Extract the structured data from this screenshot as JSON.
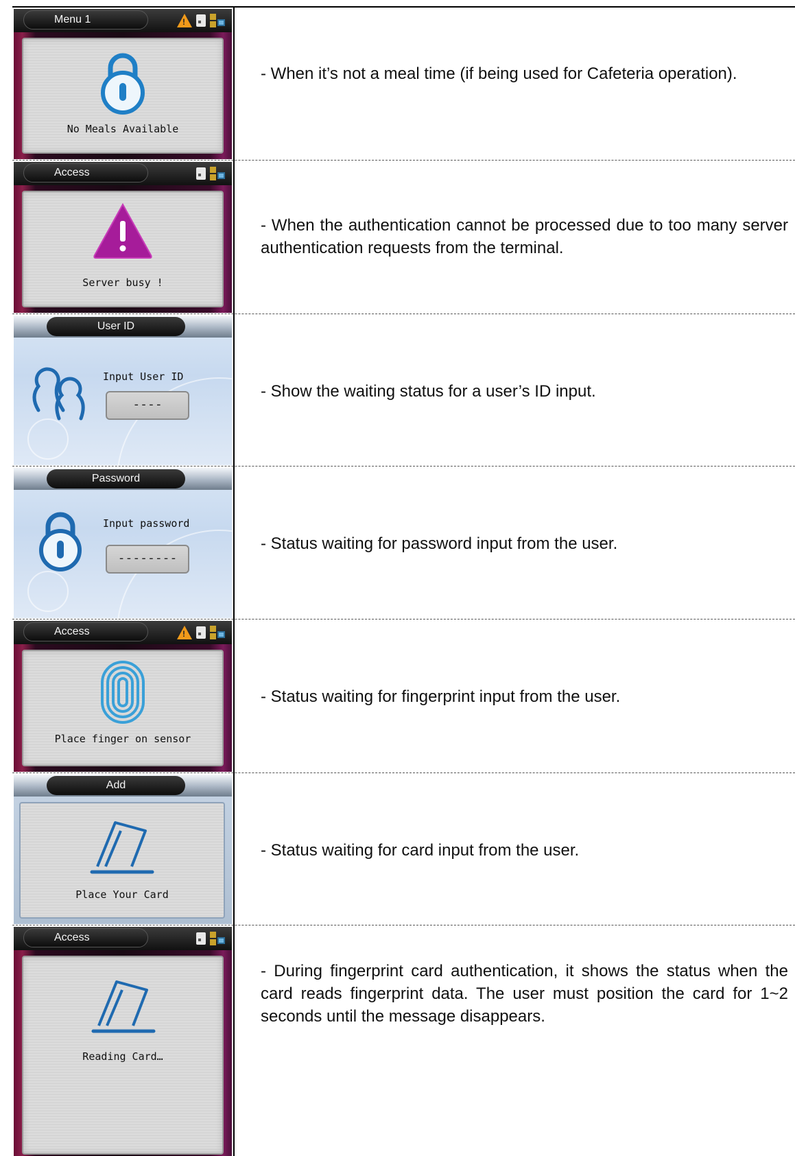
{
  "rows": [
    {
      "screen": {
        "title": "Menu 1",
        "label": "No Meals Available",
        "icon": "lock-icon",
        "theme": "dark",
        "status_icons": [
          "warning-icon",
          "sd-card-icon",
          "network-icon"
        ]
      },
      "description": "- When it’s not a meal time (if being used for Cafeteria operation)."
    },
    {
      "screen": {
        "title": "Access",
        "label": "Server busy !",
        "icon": "warning-triangle-icon",
        "theme": "dark",
        "status_icons": [
          "sd-card-icon",
          "network-icon"
        ]
      },
      "description": "- When the authentication cannot be processed due to too many server authentication requests from the terminal."
    },
    {
      "screen": {
        "title": "User ID",
        "label": "Input User ID",
        "input_value": "----",
        "icon": "users-icon",
        "theme": "light"
      },
      "description": "- Show the waiting status for a user’s ID input."
    },
    {
      "screen": {
        "title": "Password",
        "label": "Input password",
        "input_value": "--------",
        "icon": "lock-icon",
        "theme": "light"
      },
      "description": "- Status waiting for password input from the user."
    },
    {
      "screen": {
        "title": "Access",
        "label": "Place finger on sensor",
        "icon": "fingerprint-icon",
        "theme": "dark",
        "status_icons": [
          "warning-icon",
          "sd-card-icon",
          "network-icon"
        ]
      },
      "description": "- Status waiting for fingerprint input from the user."
    },
    {
      "screen": {
        "title": "Add",
        "label": "Place Your Card",
        "icon": "card-icon",
        "theme": "light-silver"
      },
      "description": "- Status waiting for card input from the user."
    },
    {
      "screen": {
        "title": "Access",
        "label": "Reading Card…",
        "icon": "card-icon",
        "theme": "dark",
        "status_icons": [
          "sd-card-icon",
          "network-icon"
        ]
      },
      "description": "- During fingerprint card authentication, it shows the status when the card reads fingerprint data. The user must position the card for 1~2 seconds until the message disappears."
    }
  ]
}
